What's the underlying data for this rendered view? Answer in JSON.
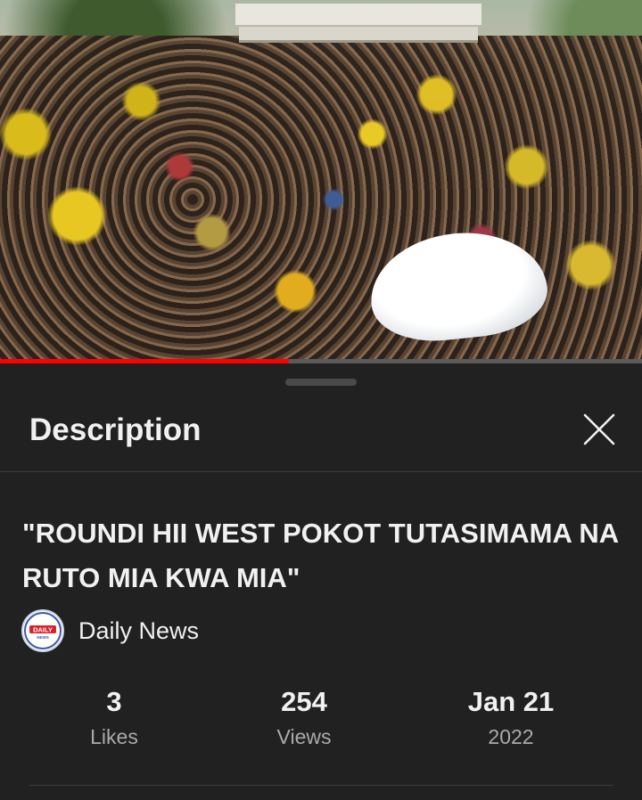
{
  "video": {
    "progress_fraction": 0.45
  },
  "sheet": {
    "title": "Description",
    "close_icon": "close-icon"
  },
  "video_title": "\"ROUNDI HII WEST POKOT TUTASIMAMA NA RUTO MIA KWA MIA\"",
  "channel": {
    "name": "Daily News",
    "avatar_text": "DAILY",
    "avatar_subtext": "NEWS"
  },
  "stats": {
    "likes_value": "3",
    "likes_label": "Likes",
    "views_value": "254",
    "views_label": "Views",
    "date_value": "Jan 21",
    "date_year": "2022"
  },
  "colors": {
    "background": "#212121",
    "progress": "#ff0000",
    "text_primary": "#f1f1f1",
    "text_secondary": "#aaaaaa"
  }
}
